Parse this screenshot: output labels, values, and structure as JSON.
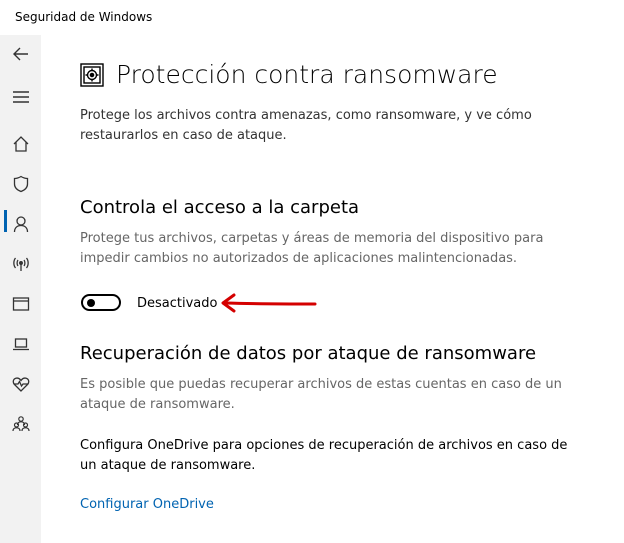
{
  "window": {
    "title": "Seguridad de Windows"
  },
  "sidebar": {
    "items": [
      {
        "name": "back",
        "icon": "back-arrow-icon"
      },
      {
        "name": "menu",
        "icon": "hamburger-menu-icon"
      },
      {
        "name": "home",
        "icon": "home-icon"
      },
      {
        "name": "virus-protection",
        "icon": "shield-icon",
        "active": true
      },
      {
        "name": "account-protection",
        "icon": "person-icon"
      },
      {
        "name": "firewall-network",
        "icon": "wireless-antenna-icon"
      },
      {
        "name": "app-browser-control",
        "icon": "browser-window-icon"
      },
      {
        "name": "device-security",
        "icon": "laptop-icon"
      },
      {
        "name": "device-health",
        "icon": "heart-pulse-icon"
      },
      {
        "name": "family-options",
        "icon": "family-icon"
      }
    ],
    "accent_color": "#0063b1"
  },
  "page": {
    "header_icon": "ransomware-vault-icon",
    "title": "Protección contra ransomware",
    "description": "Protege los archivos contra amenazas, como ransomware, y ve cómo restaurarlos en caso de ataque."
  },
  "folder_access": {
    "title": "Controla el acceso a la carpeta",
    "description": "Protege tus archivos, carpetas y áreas de memoria del dispositivo para impedir cambios no autorizados de aplicaciones malintencionadas.",
    "toggle_state": "off",
    "toggle_label": "Desactivado",
    "annotation_arrow_color": "#d40000"
  },
  "recovery": {
    "title": "Recuperación de datos por ataque de ransomware",
    "description": "Es posible que puedas recuperar archivos de estas cuentas en caso de un ataque de ransomware.",
    "onedrive_text": "Configura OneDrive para opciones de recuperación de archivos en caso de un ataque de ransomware.",
    "link_label": "Configurar OneDrive",
    "link_color": "#0063b1"
  }
}
